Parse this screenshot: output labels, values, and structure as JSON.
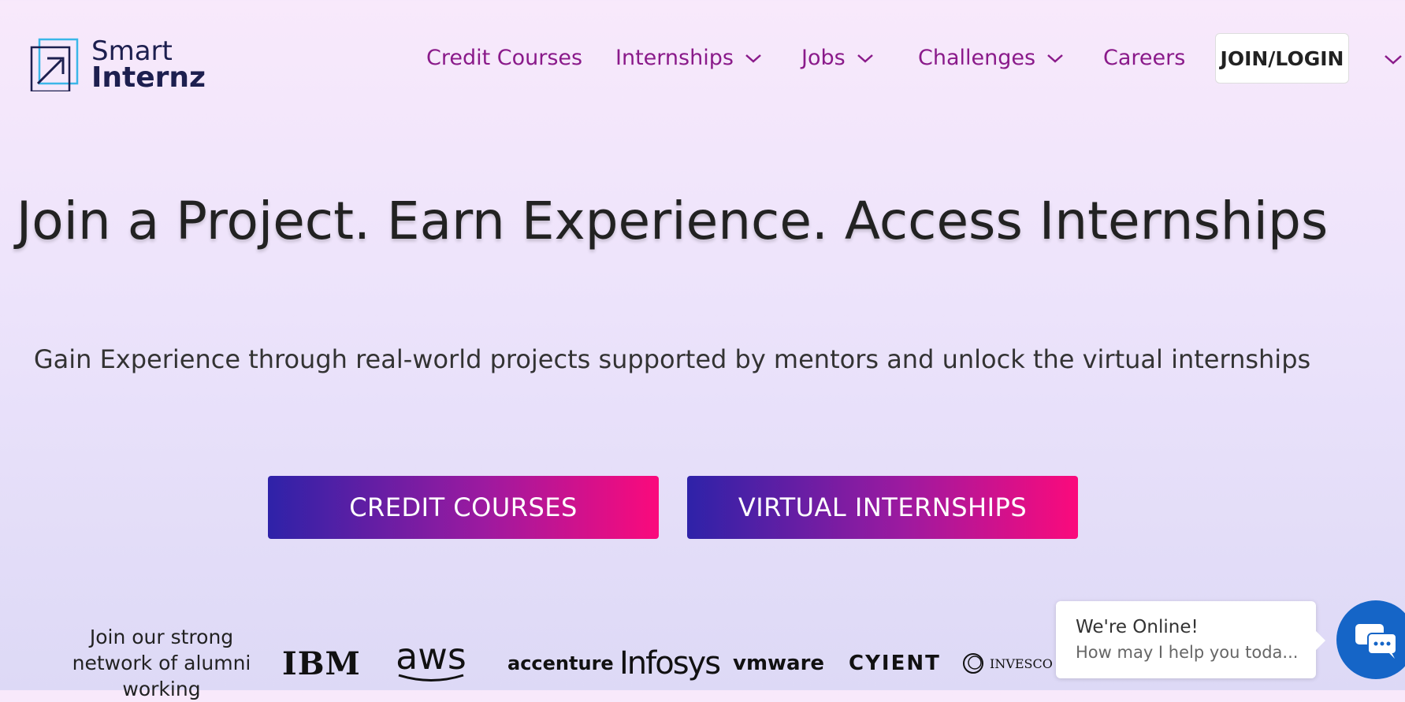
{
  "brand": {
    "line1": "Smart",
    "line2": "Internz",
    "icon": "smartinternz-logo-icon"
  },
  "nav": {
    "items": [
      {
        "label": "Credit Courses",
        "dropdown": false
      },
      {
        "label": "Internships",
        "dropdown": true
      },
      {
        "label": "Jobs",
        "dropdown": true
      },
      {
        "label": "Challenges",
        "dropdown": true
      },
      {
        "label": "Careers",
        "dropdown": false
      }
    ],
    "join_label": "JOIN/LOGIN",
    "more_icon": "chevron-down-icon"
  },
  "hero": {
    "title": "Join a Project. Earn Experience. Access Internships",
    "subtitle": "Gain Experience through real-world projects supported by mentors and unlock the virtual internships",
    "cta_primary": "CREDIT COURSES",
    "cta_secondary": "VIRTUAL INTERNSHIPS"
  },
  "alumni": {
    "text": "Join our strong network of alumni working",
    "companies": [
      "IBM",
      "aws",
      "accenture",
      "Infosys",
      "vmware",
      "CYIENT",
      "INVESCO"
    ]
  },
  "chat": {
    "title": "We're Online!",
    "message": "How may I help you toda...",
    "icon": "chat-bubbles-icon"
  },
  "colors": {
    "nav_link": "#8a1a8a",
    "brand_navy": "#1d1f4f",
    "cta_gradient_start": "#2e22a8",
    "cta_gradient_end": "#fb0a7c",
    "chat_blue": "#1565c7"
  }
}
